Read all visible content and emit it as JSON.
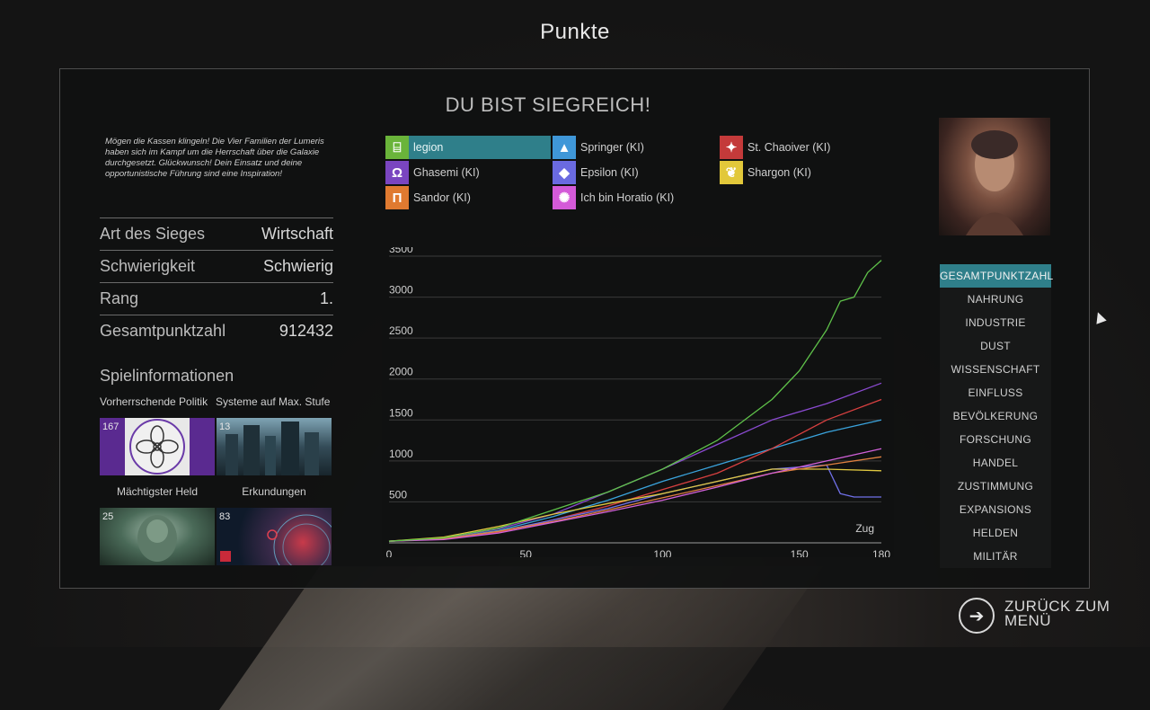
{
  "window": {
    "title": "Punkte"
  },
  "victory_title": "DU BIST SIEGREICH!",
  "flavor_text": "Mögen die Kassen klingeln! Die Vier Familien der Lumeris haben sich im Kampf um die Herrschaft über die Galaxie durchgesetzt. Glückwunsch! Dein Einsatz und deine opportunistische Führung sind eine Inspiration!",
  "stats": [
    {
      "label": "Art des Sieges",
      "value": "Wirtschaft"
    },
    {
      "label": "Schwierigkeit",
      "value": "Schwierig"
    },
    {
      "label": "Rang",
      "value": "1."
    },
    {
      "label": "Gesamtpunktzahl",
      "value": "912432"
    }
  ],
  "game_info": {
    "title": "Spielinformationen",
    "tiles": [
      {
        "caption": "Vorherrschende Politik",
        "value": "167"
      },
      {
        "caption": "Systeme auf Max. Stufe",
        "value": "13"
      },
      {
        "caption": "Mächtigster Held",
        "value": "25"
      },
      {
        "caption": "Erkundungen",
        "value": "83"
      }
    ]
  },
  "empires": [
    {
      "name": "legion",
      "color": "#6ab43a",
      "icon": "legion-faction-icon",
      "selected": true
    },
    {
      "name": "Springer (KI)",
      "color": "#3f97d8",
      "icon": "springer-faction-icon"
    },
    {
      "name": "St. Chaoiver (KI)",
      "color": "#c43a3a",
      "icon": "chaoiver-faction-icon"
    },
    {
      "name": "Ghasemi (KI)",
      "color": "#7a45c0",
      "icon": "ghasemi-faction-icon"
    },
    {
      "name": "Epsilon (KI)",
      "color": "#6a6ae0",
      "icon": "epsilon-faction-icon"
    },
    {
      "name": "Shargon (KI)",
      "color": "#e2c83a",
      "icon": "shargon-faction-icon"
    },
    {
      "name": "Sandor (KI)",
      "color": "#e07a30",
      "icon": "sandor-faction-icon"
    },
    {
      "name": "Ich bin Horatio (KI)",
      "color": "#d45ad8",
      "icon": "horatio-faction-icon"
    }
  ],
  "categories": [
    {
      "label": "GESAMTPUNKTZAHL",
      "active": true
    },
    {
      "label": "NAHRUNG"
    },
    {
      "label": "INDUSTRIE"
    },
    {
      "label": "DUST"
    },
    {
      "label": "WISSENSCHAFT"
    },
    {
      "label": "EINFLUSS"
    },
    {
      "label": "BEVÖLKERUNG"
    },
    {
      "label": "FORSCHUNG"
    },
    {
      "label": "HANDEL"
    },
    {
      "label": "ZUSTIMMUNG"
    },
    {
      "label": "EXPANSIONS"
    },
    {
      "label": "HELDEN"
    },
    {
      "label": "MILITÄR"
    }
  ],
  "back_button": {
    "label": "ZURÜCK ZUM MENÜ"
  },
  "chart_data": {
    "type": "line",
    "xlabel": "Zug",
    "ylabel": "",
    "xlim": [
      0,
      180
    ],
    "ylim": [
      0,
      3500
    ],
    "x_ticks": [
      0,
      50,
      100,
      150,
      180
    ],
    "y_ticks": [
      500,
      1000,
      1500,
      2000,
      2500,
      3000,
      3500
    ],
    "grid": true,
    "series": [
      {
        "name": "legion",
        "color": "#5fc24a",
        "x": [
          0,
          20,
          40,
          60,
          80,
          100,
          120,
          140,
          150,
          160,
          165,
          170,
          175,
          180
        ],
        "y": [
          20,
          60,
          180,
          400,
          620,
          900,
          1250,
          1750,
          2100,
          2600,
          2950,
          3000,
          3300,
          3450
        ]
      },
      {
        "name": "Springer (KI)",
        "color": "#3aa3dc",
        "x": [
          0,
          20,
          40,
          60,
          80,
          100,
          120,
          140,
          160,
          180
        ],
        "y": [
          20,
          50,
          150,
          320,
          520,
          750,
          950,
          1150,
          1350,
          1500
        ]
      },
      {
        "name": "St. Chaoiver (KI)",
        "color": "#d84040",
        "x": [
          0,
          20,
          40,
          60,
          80,
          100,
          120,
          140,
          160,
          180
        ],
        "y": [
          20,
          50,
          130,
          280,
          450,
          650,
          850,
          1150,
          1500,
          1750
        ]
      },
      {
        "name": "Ghasemi (KI)",
        "color": "#8a4ad0",
        "x": [
          0,
          20,
          40,
          60,
          80,
          100,
          120,
          140,
          160,
          180
        ],
        "y": [
          20,
          60,
          170,
          350,
          620,
          900,
          1200,
          1500,
          1700,
          1950
        ]
      },
      {
        "name": "Epsilon (KI)",
        "color": "#7070e8",
        "x": [
          0,
          20,
          40,
          60,
          80,
          100,
          120,
          140,
          160,
          165,
          170,
          180
        ],
        "y": [
          20,
          50,
          140,
          280,
          420,
          600,
          750,
          900,
          950,
          600,
          560,
          560
        ]
      },
      {
        "name": "Shargon (KI)",
        "color": "#e0c840",
        "x": [
          0,
          20,
          40,
          60,
          80,
          100,
          120,
          140,
          160,
          180
        ],
        "y": [
          20,
          70,
          200,
          350,
          480,
          600,
          750,
          900,
          900,
          880
        ]
      },
      {
        "name": "Sandor (KI)",
        "color": "#e08040",
        "x": [
          0,
          20,
          40,
          60,
          80,
          100,
          120,
          140,
          160,
          180
        ],
        "y": [
          20,
          50,
          140,
          260,
          400,
          550,
          700,
          850,
          950,
          1050
        ]
      },
      {
        "name": "Ich bin Horatio (KI)",
        "color": "#d060d8",
        "x": [
          0,
          20,
          40,
          60,
          80,
          100,
          120,
          140,
          160,
          180
        ],
        "y": [
          20,
          40,
          120,
          250,
          380,
          520,
          680,
          850,
          1000,
          1150
        ]
      }
    ]
  }
}
